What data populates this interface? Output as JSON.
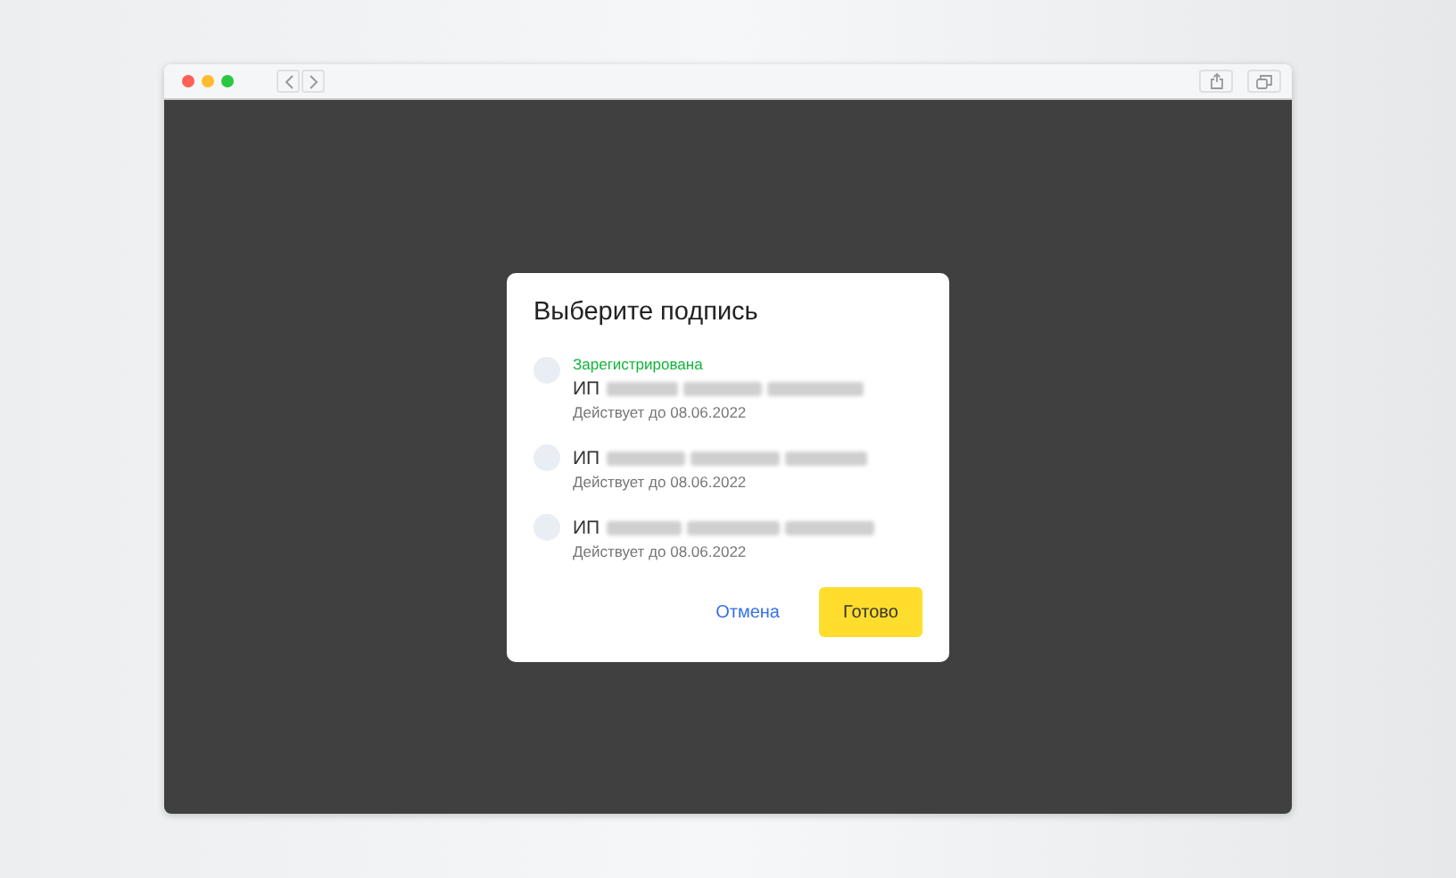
{
  "dialog": {
    "title": "Выберите подпись",
    "signatures": [
      {
        "status": "Зарегистрирована",
        "owner": "ИП",
        "validity": "Действует до 08.06.2022",
        "selected": false
      },
      {
        "owner": "ИП",
        "validity": "Действует до 08.06.2022",
        "selected": false
      },
      {
        "owner": "ИП",
        "validity": "Действует до 08.06.2022",
        "selected": false
      }
    ],
    "buttons": [
      {
        "kind": "link",
        "label": "Отмена"
      },
      {
        "kind": "primary",
        "label": "Готово"
      }
    ]
  }
}
